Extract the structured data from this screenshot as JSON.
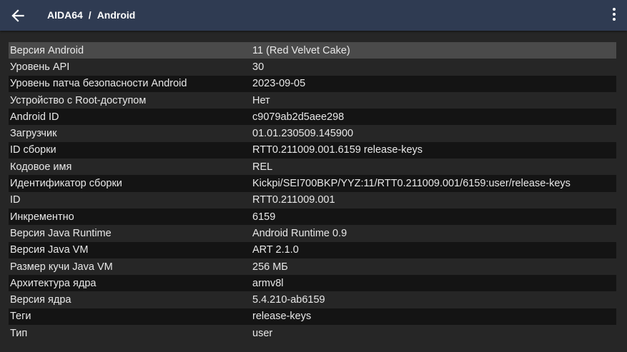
{
  "header": {
    "back_icon": "arrow-left-icon",
    "app_name": "AIDA64",
    "separator": "/",
    "section": "Android",
    "menu_icon": "more-vert-icon"
  },
  "colors": {
    "topbar": "#2f3b52",
    "background": "#262626",
    "row_dark": "#141414",
    "row_selected": "#4a4a4a",
    "text": "#e8e8e8"
  },
  "rows": [
    {
      "label": "Версия Android",
      "value": "11 (Red Velvet Cake)"
    },
    {
      "label": "Уровень API",
      "value": "30"
    },
    {
      "label": "Уровень патча безопасности Android",
      "value": "2023-09-05"
    },
    {
      "label": "Устройство с Root-доступом",
      "value": "Нет"
    },
    {
      "label": "Android ID",
      "value": "c9079ab2d5aee298"
    },
    {
      "label": "Загрузчик",
      "value": "01.01.230509.145900"
    },
    {
      "label": "ID сборки",
      "value": "RTT0.211009.001.6159 release-keys"
    },
    {
      "label": "Кодовое имя",
      "value": "REL"
    },
    {
      "label": "Идентификатор сборки",
      "value": "Kickpi/SEI700BKP/YYZ:11/RTT0.211009.001/6159:user/release-keys"
    },
    {
      "label": "ID",
      "value": "RTT0.211009.001"
    },
    {
      "label": "Инкрементно",
      "value": "6159"
    },
    {
      "label": "Версия Java Runtime",
      "value": "Android Runtime 0.9"
    },
    {
      "label": "Версия Java VM",
      "value": "ART 2.1.0"
    },
    {
      "label": "Размер кучи Java VM",
      "value": "256 МБ"
    },
    {
      "label": "Архитектура ядра",
      "value": "armv8l"
    },
    {
      "label": "Версия ядра",
      "value": "5.4.210-ab6159"
    },
    {
      "label": "Теги",
      "value": "release-keys"
    },
    {
      "label": "Тип",
      "value": "user"
    }
  ]
}
